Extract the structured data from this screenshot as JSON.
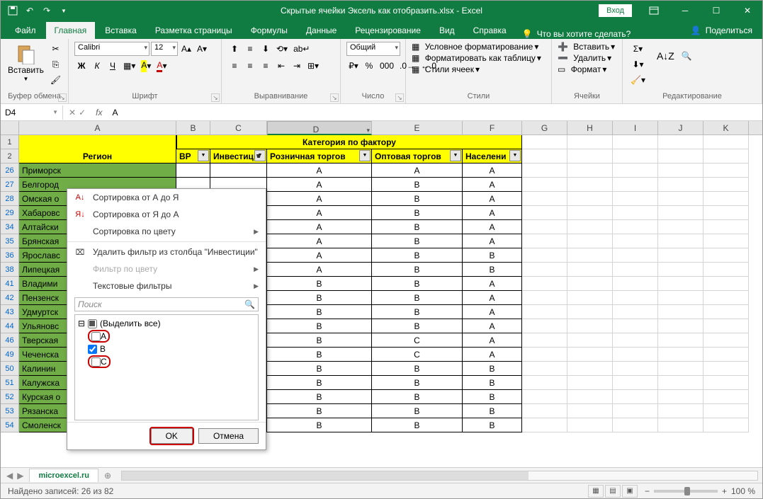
{
  "title": "Скрытые ячейки Эксель как отобразить.xlsx - Excel",
  "login": "Вход",
  "tabs": [
    "Файл",
    "Главная",
    "Вставка",
    "Разметка страницы",
    "Формулы",
    "Данные",
    "Рецензирование",
    "Вид",
    "Справка"
  ],
  "tell_me": "Что вы хотите сделать?",
  "share": "Поделиться",
  "ribbon": {
    "clipboard": {
      "paste": "Вставить",
      "label": "Буфер обмена"
    },
    "font": {
      "name": "Calibri",
      "size": "12",
      "label": "Шрифт",
      "bold": "Ж",
      "italic": "К",
      "underline": "Ч"
    },
    "align": {
      "label": "Выравнивание"
    },
    "number": {
      "format": "Общий",
      "label": "Число"
    },
    "styles": {
      "cond": "Условное форматирование",
      "table": "Форматировать как таблицу",
      "cell": "Стили ячеек",
      "label": "Стили"
    },
    "cells": {
      "insert": "Вставить",
      "delete": "Удалить",
      "format": "Формат",
      "label": "Ячейки"
    },
    "editing": {
      "label": "Редактирование"
    }
  },
  "namebox": "D4",
  "formula": "А",
  "cols": [
    "A",
    "B",
    "C",
    "D",
    "E",
    "F",
    "G",
    "H",
    "I",
    "J",
    "K"
  ],
  "hdrs": {
    "region": "Регион",
    "cat": "Категория по фактору",
    "b": "ВР",
    "c": "Инвестици",
    "d": "Розничная торгов",
    "e": "Оптовая торгов",
    "f": "Населени"
  },
  "rows": [
    {
      "n": 26,
      "a": "Приморск",
      "d": "А",
      "e": "А",
      "f": "А"
    },
    {
      "n": 27,
      "a": "Белгород",
      "d": "А",
      "e": "В",
      "f": "А"
    },
    {
      "n": 28,
      "a": "Омская о",
      "d": "А",
      "e": "В",
      "f": "А"
    },
    {
      "n": 29,
      "a": "Хабаровс",
      "d": "А",
      "e": "В",
      "f": "А"
    },
    {
      "n": 34,
      "a": "Алтайски",
      "d": "А",
      "e": "В",
      "f": "А"
    },
    {
      "n": 35,
      "a": "Брянская",
      "d": "А",
      "e": "В",
      "f": "А"
    },
    {
      "n": 36,
      "a": "Ярославс",
      "d": "А",
      "e": "В",
      "f": "В"
    },
    {
      "n": 38,
      "a": "Липецкая",
      "d": "А",
      "e": "В",
      "f": "В"
    },
    {
      "n": 41,
      "a": "Владими",
      "d": "В",
      "e": "В",
      "f": "А"
    },
    {
      "n": 42,
      "a": "Пензенск",
      "d": "В",
      "e": "В",
      "f": "А"
    },
    {
      "n": 43,
      "a": "Удмуртск",
      "d": "В",
      "e": "В",
      "f": "А"
    },
    {
      "n": 44,
      "a": "Ульяновс",
      "d": "В",
      "e": "В",
      "f": "А"
    },
    {
      "n": 46,
      "a": "Тверская",
      "d": "В",
      "e": "С",
      "f": "А"
    },
    {
      "n": 49,
      "a": "Чеченска",
      "d": "В",
      "e": "С",
      "f": "А"
    },
    {
      "n": 50,
      "a": "Калинин",
      "d": "В",
      "e": "В",
      "f": "В"
    },
    {
      "n": 51,
      "a": "Калужска",
      "d": "В",
      "e": "В",
      "f": "В"
    },
    {
      "n": 52,
      "a": "Курская о",
      "d": "В",
      "e": "В",
      "f": "В"
    },
    {
      "n": 53,
      "a": "Рязанска",
      "d": "В",
      "e": "В",
      "f": "В"
    },
    {
      "n": 54,
      "a": "Смоленск",
      "d": "В",
      "e": "В",
      "f": "В"
    }
  ],
  "dropdown": {
    "sort_az": "Сортировка от А до Я",
    "sort_za": "Сортировка от Я до А",
    "sort_color": "Сортировка по цвету",
    "clear": "Удалить фильтр из столбца \"Инвестиции\"",
    "filter_color": "Фильтр по цвету",
    "text_filter": "Текстовые фильтры",
    "search": "Поиск",
    "all": "(Выделить все)",
    "a": "А",
    "b": "В",
    "c": "С",
    "ok": "OK",
    "cancel": "Отмена"
  },
  "sheet_tab": "microexcel.ru",
  "status": "Найдено записей: 26 из 82",
  "zoom": "100 %"
}
